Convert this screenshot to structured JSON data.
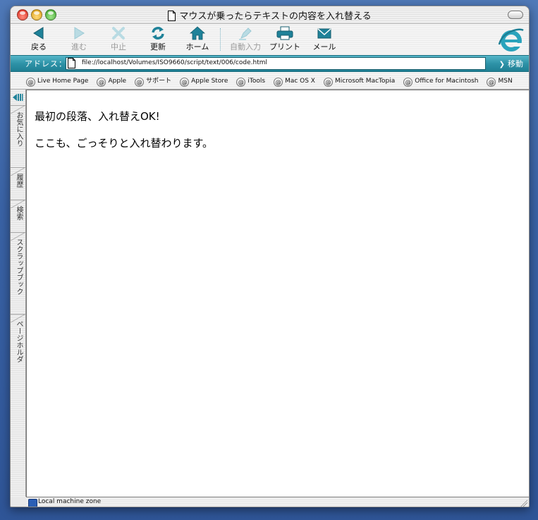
{
  "window": {
    "title": "マウスが乗ったらテキストの内容を入れ替える"
  },
  "toolbar": {
    "back": "戻る",
    "forward": "進む",
    "stop": "中止",
    "refresh": "更新",
    "home": "ホーム",
    "autofill": "自動入力",
    "print": "プリント",
    "mail": "メール"
  },
  "address": {
    "label": "アドレス：",
    "url": "file://localhost/Volumes/ISO9660/script/text/006/code.html",
    "go": "移動"
  },
  "favorites": [
    "Live Home Page",
    "Apple",
    "サポート",
    "Apple Store",
    "iTools",
    "Mac OS X",
    "Microsoft MacTopia",
    "Office for Macintosh",
    "MSN"
  ],
  "sidebar": {
    "tabs": [
      "お気に入り",
      "履歴",
      "検索",
      "スクラップブック",
      "ページホルダ"
    ]
  },
  "page": {
    "para1": "最初の段落、入れ替えOK!",
    "para2": "ここも、ごっそりと入れ替わります。"
  },
  "status": {
    "zone": "Local machine zone"
  },
  "colors": {
    "accent": "#2e93a8",
    "toolbar_icon": "#1f8299",
    "desktop": "#3a63a6"
  }
}
